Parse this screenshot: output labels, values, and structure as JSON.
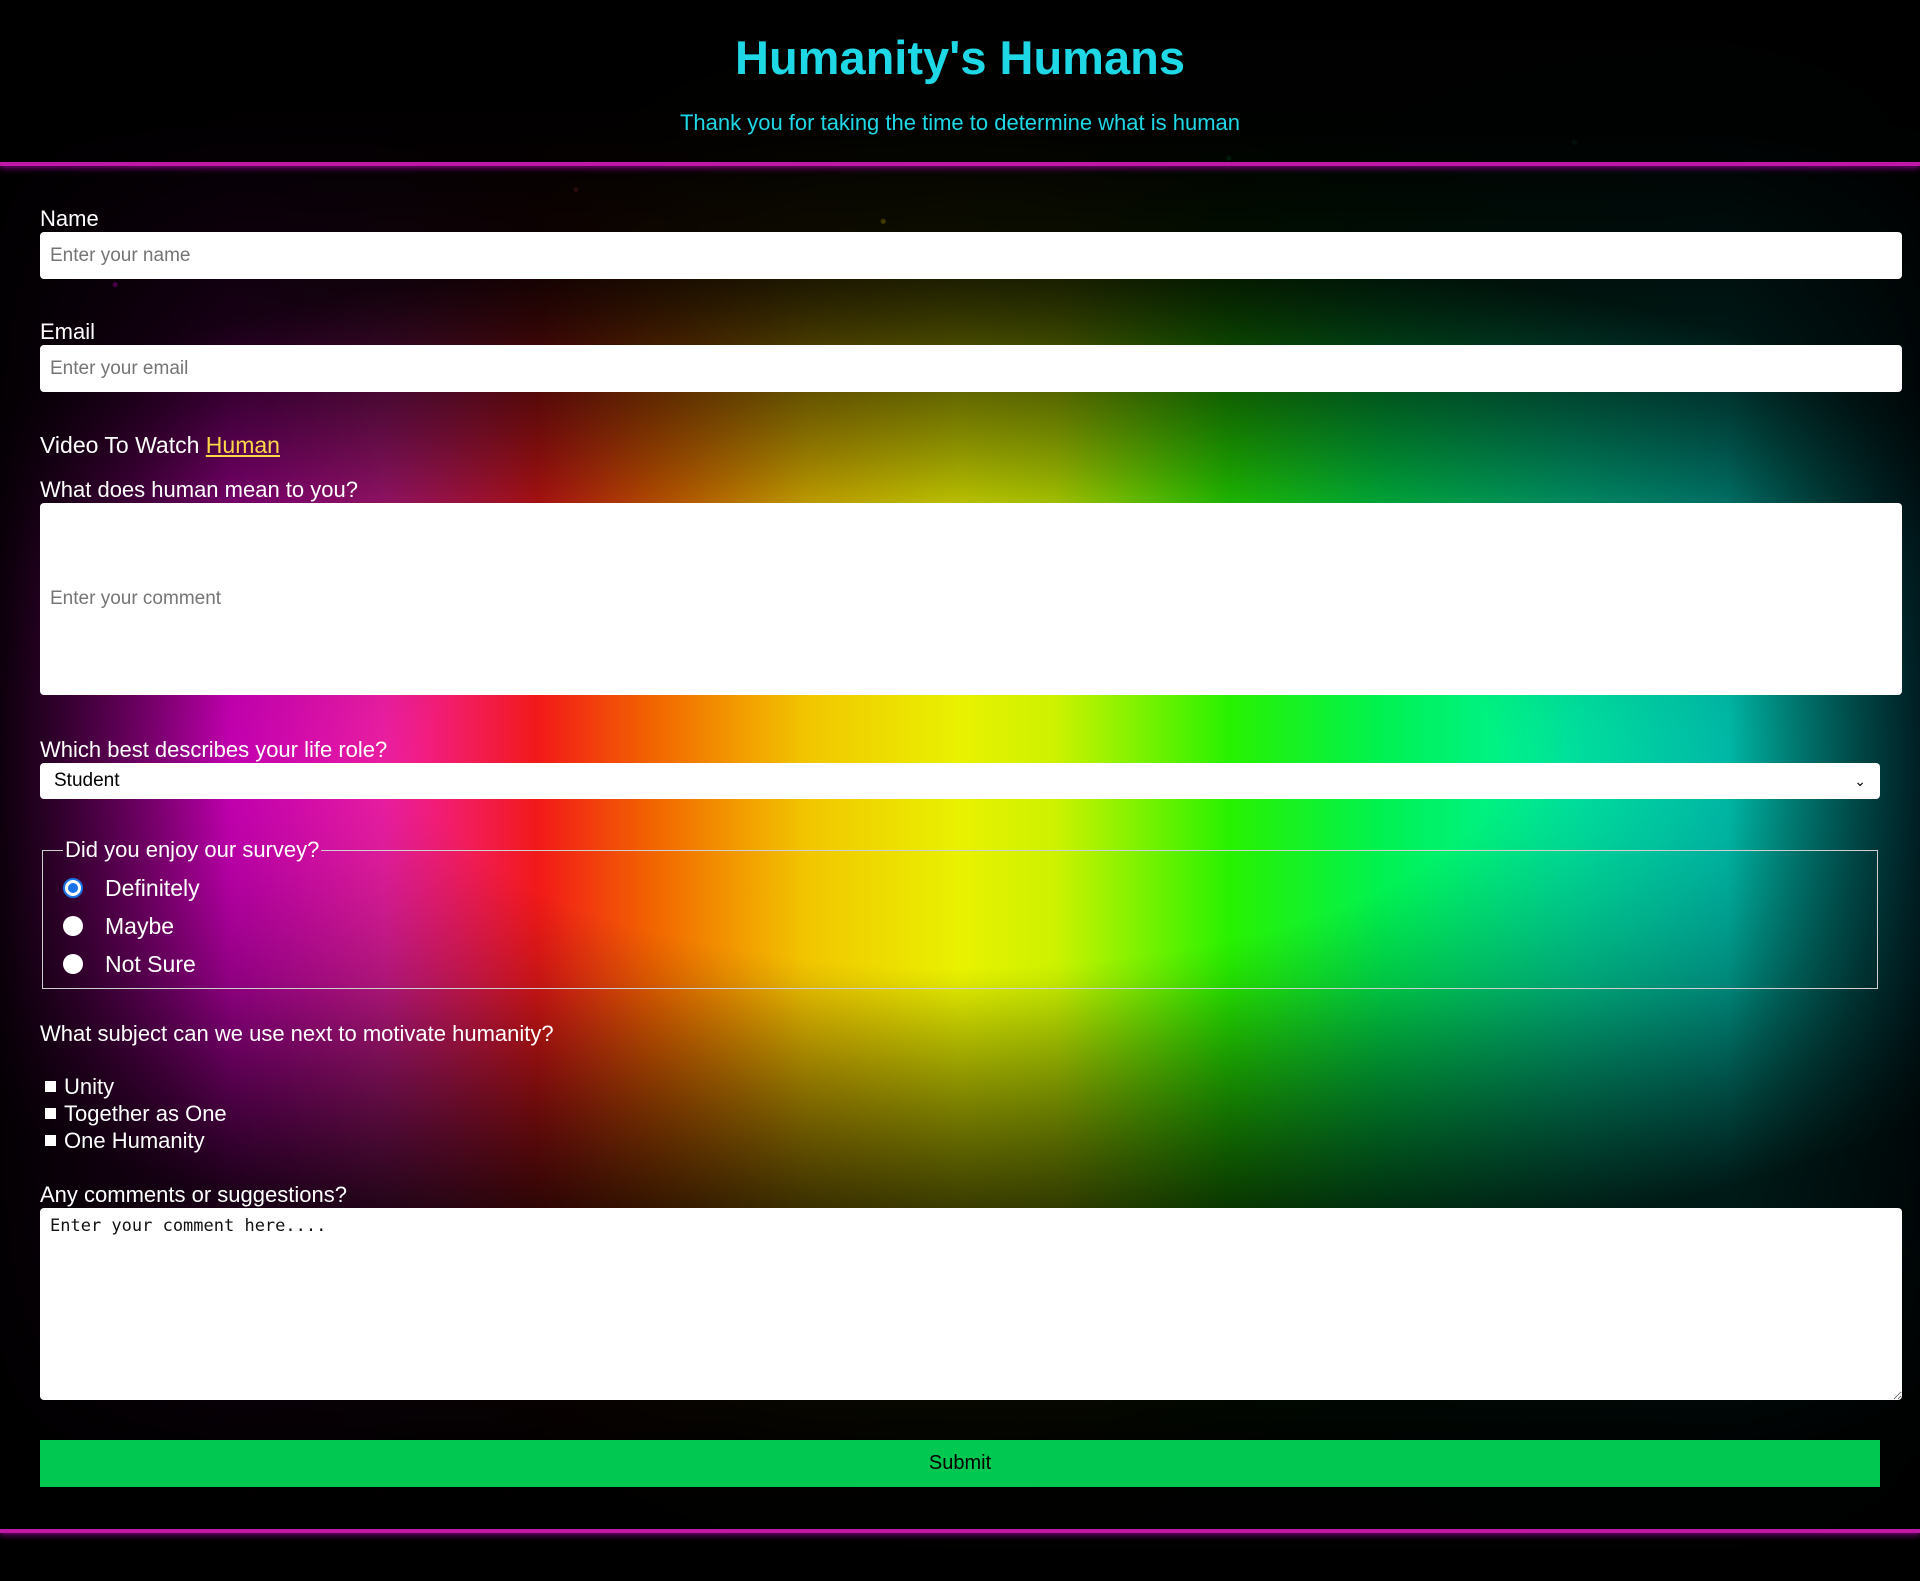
{
  "header": {
    "title": "Humanity's Humans",
    "subtitle": "Thank you for taking the time to determine what is human"
  },
  "form": {
    "name": {
      "label": "Name",
      "placeholder": "Enter your name"
    },
    "email": {
      "label": "Email",
      "placeholder": "Enter your email"
    },
    "video": {
      "prefix": "Video To Watch",
      "link_text": "Human"
    },
    "meaning": {
      "label": "What does human mean to you?",
      "placeholder": "Enter your comment"
    },
    "life_role": {
      "label": "Which best describes your life role?",
      "selected": "Student"
    },
    "enjoy": {
      "legend": "Did you enjoy our survey?",
      "options": [
        "Definitely",
        "Maybe",
        "Not Sure"
      ],
      "selected": "Definitely"
    },
    "subject": {
      "question": "What subject can we use next to motivate humanity?",
      "options": [
        "Unity",
        "Together as One",
        "One Humanity"
      ]
    },
    "comments": {
      "label": "Any comments or suggestions?",
      "value": "Enter your comment here...."
    },
    "submit_label": "Submit"
  },
  "colors": {
    "heading": "#1fd8e6",
    "link": "#ffd84a",
    "submit": "#00c851",
    "divider": "#c01aa5",
    "radio_checked": "#1a73e8"
  }
}
